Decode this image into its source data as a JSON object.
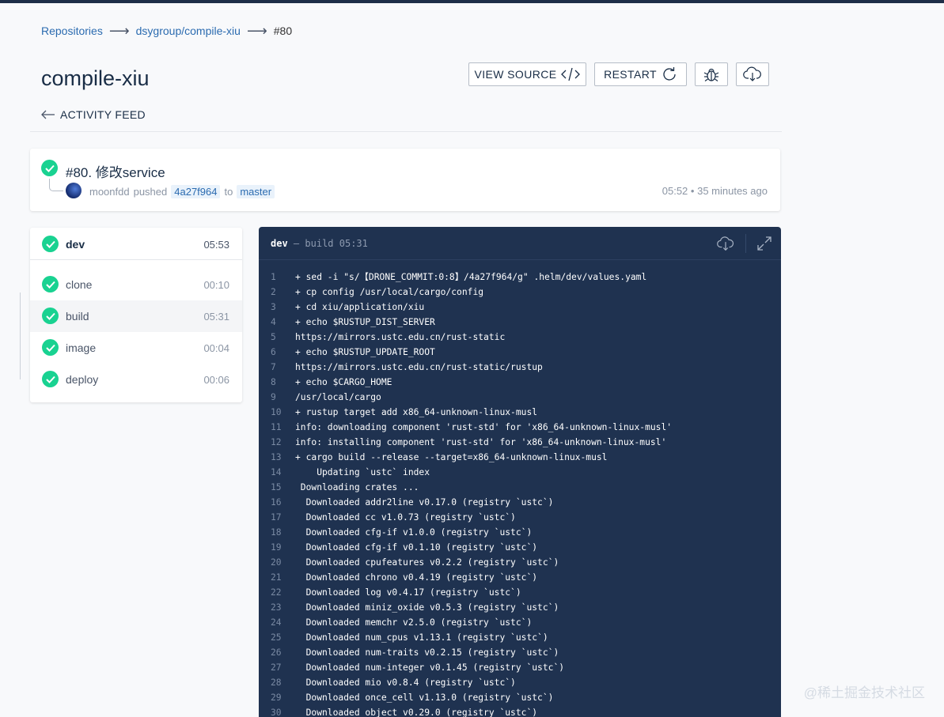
{
  "breadcrumb": {
    "items": [
      "Repositories",
      "dsygroup/compile-xiu"
    ],
    "current": "#80"
  },
  "page": {
    "title": "compile-xiu"
  },
  "actions": {
    "view_source": "VIEW SOURCE",
    "restart": "RESTART",
    "debug_icon": "bug-icon",
    "download_icon": "cloud-download-icon"
  },
  "activity_feed": {
    "label": "ACTIVITY FEED"
  },
  "commit": {
    "title": "#80. 修改service",
    "author": "moonfdd",
    "action": "pushed",
    "sha": "4a27f964",
    "to": "to",
    "branch": "master",
    "time": "05:52",
    "ago": "35 minutes ago"
  },
  "stage": {
    "name": "dev",
    "duration": "05:53",
    "steps": [
      {
        "name": "clone",
        "duration": "00:10"
      },
      {
        "name": "build",
        "duration": "05:31"
      },
      {
        "name": "image",
        "duration": "00:04"
      },
      {
        "name": "deploy",
        "duration": "00:06"
      }
    ]
  },
  "log": {
    "stage": "dev",
    "separator": "—",
    "step": "build",
    "duration": "05:31",
    "lines": [
      "+ sed -i \"s/【DRONE_COMMIT:0:8】/4a27f964/g\" .helm/dev/values.yaml",
      "+ cp config /usr/local/cargo/config",
      "+ cd xiu/application/xiu",
      "+ echo $RUSTUP_DIST_SERVER",
      "https://mirrors.ustc.edu.cn/rust-static",
      "+ echo $RUSTUP_UPDATE_ROOT",
      "https://mirrors.ustc.edu.cn/rust-static/rustup",
      "+ echo $CARGO_HOME",
      "/usr/local/cargo",
      "+ rustup target add x86_64-unknown-linux-musl",
      "info: downloading component 'rust-std' for 'x86_64-unknown-linux-musl'",
      "info: installing component 'rust-std' for 'x86_64-unknown-linux-musl'",
      "+ cargo build --release --target=x86_64-unknown-linux-musl",
      "    Updating `ustc` index",
      " Downloading crates ...",
      "  Downloaded addr2line v0.17.0 (registry `ustc`)",
      "  Downloaded cc v1.0.73 (registry `ustc`)",
      "  Downloaded cfg-if v1.0.0 (registry `ustc`)",
      "  Downloaded cfg-if v0.1.10 (registry `ustc`)",
      "  Downloaded cpufeatures v0.2.2 (registry `ustc`)",
      "  Downloaded chrono v0.4.19 (registry `ustc`)",
      "  Downloaded log v0.4.17 (registry `ustc`)",
      "  Downloaded miniz_oxide v0.5.3 (registry `ustc`)",
      "  Downloaded memchr v2.5.0 (registry `ustc`)",
      "  Downloaded num_cpus v1.13.1 (registry `ustc`)",
      "  Downloaded num-traits v0.2.15 (registry `ustc`)",
      "  Downloaded num-integer v0.1.45 (registry `ustc`)",
      "  Downloaded mio v0.8.4 (registry `ustc`)",
      "  Downloaded once_cell v1.13.0 (registry `ustc`)",
      "  Downloaded object v0.29.0 (registry `ustc`)"
    ]
  },
  "watermark": "@稀土掘金技术社区"
}
